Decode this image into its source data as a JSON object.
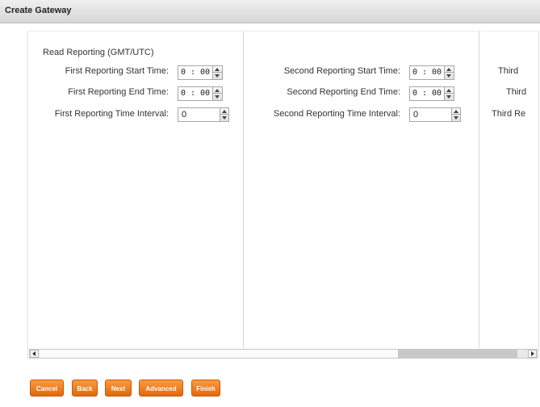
{
  "window": {
    "title": "Create Gateway"
  },
  "section": {
    "label": "Read Reporting (GMT/UTC)"
  },
  "columns": [
    {
      "start_label": "First Reporting Start Time:",
      "end_label": "First Reporting End Time:",
      "interval_label": "First Reporting Time Interval:",
      "start_value": "0 : 00",
      "end_value": "0 : 00",
      "interval_value": "0"
    },
    {
      "start_label": "Second Reporting Start Time:",
      "end_label": "Second Reporting End Time:",
      "interval_label": "Second Reporting Time Interval:",
      "start_value": "0 : 00",
      "end_value": "0 : 00",
      "interval_value": "0"
    },
    {
      "start_label": "Third",
      "end_label": "Third",
      "interval_label": "Third Re"
    }
  ],
  "buttons": {
    "cancel": "Cancel",
    "back": "Back",
    "next": "Next",
    "advanced": "Advanced",
    "finish": "Finish"
  },
  "colors": {
    "button": "#f07a1a",
    "titlebar": "#dcdcdc"
  }
}
